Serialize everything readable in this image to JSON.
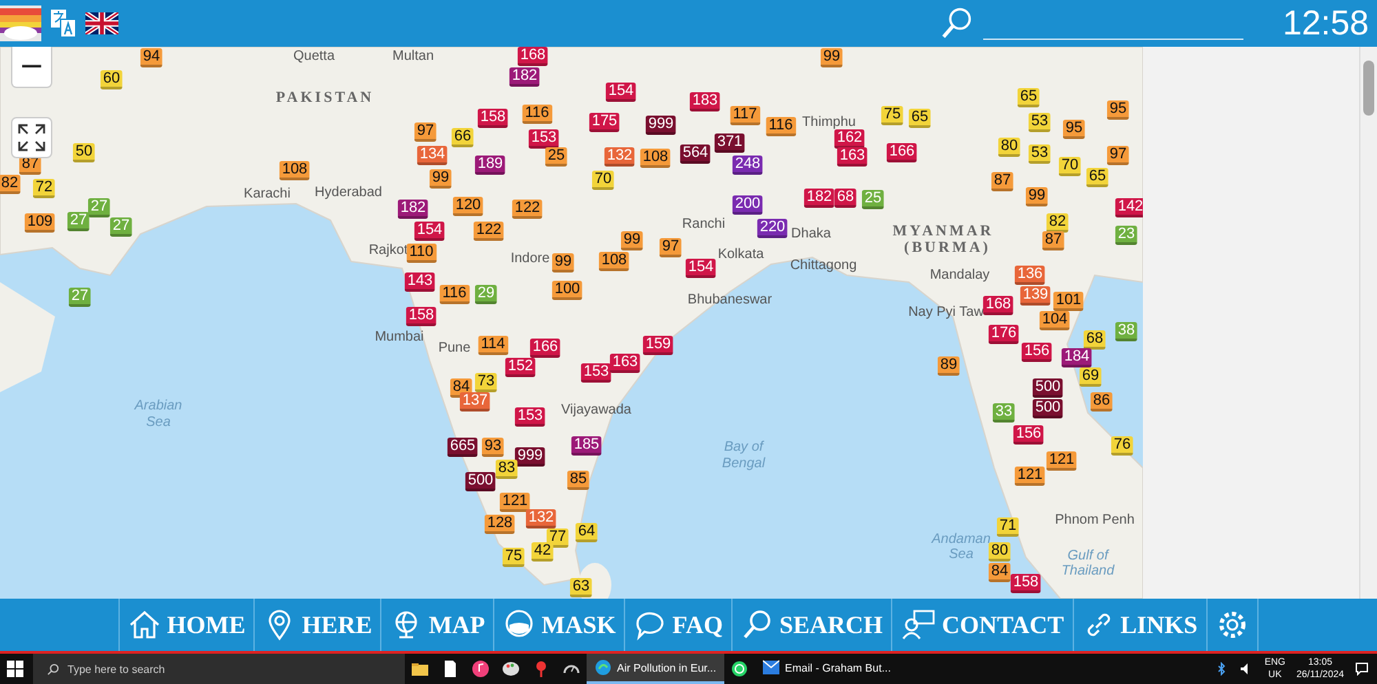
{
  "top_bar": {
    "time": "12:58"
  },
  "map": {
    "zoom_out": "−",
    "labels": [
      {
        "text": "Quetta",
        "kind": "city"
      },
      {
        "text": "Multan",
        "kind": "city"
      },
      {
        "text": "PAKISTAN",
        "kind": "country"
      },
      {
        "text": "Karachi",
        "kind": "city"
      },
      {
        "text": "Hyderabad",
        "kind": "city"
      },
      {
        "text": "Rajkot",
        "kind": "city"
      },
      {
        "text": "Indore",
        "kind": "city"
      },
      {
        "text": "Mumbai",
        "kind": "city"
      },
      {
        "text": "Pune",
        "kind": "city"
      },
      {
        "text": "Vijayawada",
        "kind": "city"
      },
      {
        "text": "Ranchi",
        "kind": "city"
      },
      {
        "text": "Kolkata",
        "kind": "city"
      },
      {
        "text": "Dhaka",
        "kind": "city"
      },
      {
        "text": "Chittagong",
        "kind": "city"
      },
      {
        "text": "Bhubaneswar",
        "kind": "city"
      },
      {
        "text": "Thimphu",
        "kind": "city"
      },
      {
        "text": "MYANMAR",
        "kind": "country"
      },
      {
        "text": "(BURMA)",
        "kind": "country"
      },
      {
        "text": "Mandalay",
        "kind": "city"
      },
      {
        "text": "Nay Pyi Taw",
        "kind": "city"
      },
      {
        "text": "Arabian",
        "kind": "sea"
      },
      {
        "text": "Sea",
        "kind": "sea"
      },
      {
        "text": "Bay of",
        "kind": "sea"
      },
      {
        "text": "Bengal",
        "kind": "sea"
      },
      {
        "text": "Phnom Penh",
        "kind": "city"
      },
      {
        "text": "Andaman",
        "kind": "sea"
      },
      {
        "text": "Sea",
        "kind": "sea"
      },
      {
        "text": "Gulf of",
        "kind": "sea"
      },
      {
        "text": "Thailand",
        "kind": "sea"
      }
    ],
    "markers": [
      {
        "value": "94",
        "color": "#f59a3a"
      },
      {
        "value": "60",
        "color": "#f2d43a"
      },
      {
        "value": "50",
        "color": "#f2d43a"
      },
      {
        "value": "87",
        "color": "#f59a3a"
      },
      {
        "value": "82",
        "color": "#f59a3a"
      },
      {
        "value": "72",
        "color": "#f2d43a"
      },
      {
        "value": "109",
        "color": "#f59a3a"
      },
      {
        "value": "27",
        "color": "#6fb040"
      },
      {
        "value": "27",
        "color": "#6fb040"
      },
      {
        "value": "27",
        "color": "#6fb040"
      },
      {
        "value": "27",
        "color": "#6fb040"
      },
      {
        "value": "108",
        "color": "#f59a3a"
      },
      {
        "value": "97",
        "color": "#f59a3a"
      },
      {
        "value": "66",
        "color": "#f2d43a"
      },
      {
        "value": "134",
        "color": "#e8663a"
      },
      {
        "value": "158",
        "color": "#d01648"
      },
      {
        "value": "153",
        "color": "#d01648"
      },
      {
        "value": "189",
        "color": "#9c1a78"
      },
      {
        "value": "99",
        "color": "#f59a3a"
      },
      {
        "value": "25",
        "color": "#f59a3a"
      },
      {
        "value": "182",
        "color": "#9c1a78"
      },
      {
        "value": "154",
        "color": "#d01648"
      },
      {
        "value": "120",
        "color": "#f59a3a"
      },
      {
        "value": "122",
        "color": "#f59a3a"
      },
      {
        "value": "122",
        "color": "#f59a3a"
      },
      {
        "value": "110",
        "color": "#f59a3a"
      },
      {
        "value": "99",
        "color": "#f59a3a"
      },
      {
        "value": "143",
        "color": "#d01648"
      },
      {
        "value": "116",
        "color": "#f59a3a"
      },
      {
        "value": "29",
        "color": "#6fb040"
      },
      {
        "value": "100",
        "color": "#f59a3a"
      },
      {
        "value": "158",
        "color": "#d01648"
      },
      {
        "value": "168",
        "color": "#d01648"
      },
      {
        "value": "182",
        "color": "#9c1a78"
      },
      {
        "value": "116",
        "color": "#f59a3a"
      },
      {
        "value": "99",
        "color": "#f59a3a"
      },
      {
        "value": "154",
        "color": "#d01648"
      },
      {
        "value": "183",
        "color": "#d01648"
      },
      {
        "value": "175",
        "color": "#d01648"
      },
      {
        "value": "999",
        "color": "#7a0f2f"
      },
      {
        "value": "117",
        "color": "#f59a3a"
      },
      {
        "value": "116",
        "color": "#f59a3a"
      },
      {
        "value": "564",
        "color": "#7a0f2f"
      },
      {
        "value": "371",
        "color": "#7a0f2f"
      },
      {
        "value": "248",
        "color": "#7a2bb0"
      },
      {
        "value": "132",
        "color": "#e8663a"
      },
      {
        "value": "108",
        "color": "#f59a3a"
      },
      {
        "value": "70",
        "color": "#f2d43a"
      },
      {
        "value": "162",
        "color": "#d01648"
      },
      {
        "value": "163",
        "color": "#d01648"
      },
      {
        "value": "166",
        "color": "#d01648"
      },
      {
        "value": "75",
        "color": "#f2d43a"
      },
      {
        "value": "65",
        "color": "#f2d43a"
      },
      {
        "value": "182",
        "color": "#d01648"
      },
      {
        "value": "68",
        "color": "#d01648"
      },
      {
        "value": "25",
        "color": "#6fb040"
      },
      {
        "value": "200",
        "color": "#7a2bb0"
      },
      {
        "value": "220",
        "color": "#7a2bb0"
      },
      {
        "value": "99",
        "color": "#f59a3a"
      },
      {
        "value": "97",
        "color": "#f59a3a"
      },
      {
        "value": "108",
        "color": "#f59a3a"
      },
      {
        "value": "154",
        "color": "#d01648"
      },
      {
        "value": "65",
        "color": "#f2d43a"
      },
      {
        "value": "53",
        "color": "#f2d43a"
      },
      {
        "value": "95",
        "color": "#f59a3a"
      },
      {
        "value": "95",
        "color": "#f59a3a"
      },
      {
        "value": "80",
        "color": "#f2d43a"
      },
      {
        "value": "53",
        "color": "#f2d43a"
      },
      {
        "value": "97",
        "color": "#f59a3a"
      },
      {
        "value": "87",
        "color": "#f59a3a"
      },
      {
        "value": "70",
        "color": "#f2d43a"
      },
      {
        "value": "65",
        "color": "#f2d43a"
      },
      {
        "value": "99",
        "color": "#f59a3a"
      },
      {
        "value": "142",
        "color": "#d01648"
      },
      {
        "value": "82",
        "color": "#f2d43a"
      },
      {
        "value": "87",
        "color": "#f59a3a"
      },
      {
        "value": "23",
        "color": "#6fb040"
      },
      {
        "value": "136",
        "color": "#e8663a"
      },
      {
        "value": "139",
        "color": "#e8663a"
      },
      {
        "value": "168",
        "color": "#d01648"
      },
      {
        "value": "101",
        "color": "#f59a3a"
      },
      {
        "value": "104",
        "color": "#f59a3a"
      },
      {
        "value": "176",
        "color": "#d01648"
      },
      {
        "value": "68",
        "color": "#f2d43a"
      },
      {
        "value": "38",
        "color": "#6fb040"
      },
      {
        "value": "184",
        "color": "#9c1a78"
      },
      {
        "value": "156",
        "color": "#d01648"
      },
      {
        "value": "69",
        "color": "#f2d43a"
      },
      {
        "value": "89",
        "color": "#f59a3a"
      },
      {
        "value": "500",
        "color": "#7a0f2f"
      },
      {
        "value": "86",
        "color": "#f59a3a"
      },
      {
        "value": "33",
        "color": "#6fb040"
      },
      {
        "value": "500",
        "color": "#7a0f2f"
      },
      {
        "value": "156",
        "color": "#d01648"
      },
      {
        "value": "121",
        "color": "#f59a3a"
      },
      {
        "value": "76",
        "color": "#f2d43a"
      },
      {
        "value": "121",
        "color": "#f59a3a"
      },
      {
        "value": "71",
        "color": "#f2d43a"
      },
      {
        "value": "80",
        "color": "#f2d43a"
      },
      {
        "value": "84",
        "color": "#f59a3a"
      },
      {
        "value": "158",
        "color": "#d01648"
      },
      {
        "value": "114",
        "color": "#f59a3a"
      },
      {
        "value": "166",
        "color": "#d01648"
      },
      {
        "value": "152",
        "color": "#d01648"
      },
      {
        "value": "153",
        "color": "#d01648"
      },
      {
        "value": "163",
        "color": "#d01648"
      },
      {
        "value": "73",
        "color": "#f2d43a"
      },
      {
        "value": "84",
        "color": "#f59a3a"
      },
      {
        "value": "137",
        "color": "#e8663a"
      },
      {
        "value": "153",
        "color": "#d01648"
      },
      {
        "value": "159",
        "color": "#d01648"
      },
      {
        "value": "665",
        "color": "#7a0f2f"
      },
      {
        "value": "93",
        "color": "#f59a3a"
      },
      {
        "value": "999",
        "color": "#7a0f2f"
      },
      {
        "value": "185",
        "color": "#9c1a78"
      },
      {
        "value": "500",
        "color": "#7a0f2f"
      },
      {
        "value": "83",
        "color": "#f2d43a"
      },
      {
        "value": "85",
        "color": "#f59a3a"
      },
      {
        "value": "121",
        "color": "#f59a3a"
      },
      {
        "value": "132",
        "color": "#e8663a"
      },
      {
        "value": "128",
        "color": "#f59a3a"
      },
      {
        "value": "77",
        "color": "#f2d43a"
      },
      {
        "value": "64",
        "color": "#f2d43a"
      },
      {
        "value": "75",
        "color": "#f2d43a"
      },
      {
        "value": "42",
        "color": "#f2d43a"
      },
      {
        "value": "63",
        "color": "#f2d43a"
      }
    ]
  },
  "nav": [
    {
      "label": "HOME",
      "kind": "home"
    },
    {
      "label": "HERE",
      "kind": "here"
    },
    {
      "label": "MAP",
      "kind": "map"
    },
    {
      "label": "MASK",
      "kind": "mask"
    },
    {
      "label": "FAQ",
      "kind": "faq"
    },
    {
      "label": "SEARCH",
      "kind": "search"
    },
    {
      "label": "CONTACT",
      "kind": "contact"
    },
    {
      "label": "LINKS",
      "kind": "links"
    },
    {
      "kind": "settings"
    }
  ],
  "taskbar": {
    "search_placeholder": "Type here to search",
    "apps": [
      {
        "label": "Air Pollution in Eur...",
        "selected": true
      },
      {
        "label": "Email - Graham But...",
        "selected": false
      }
    ],
    "language": "ENG",
    "region": "UK",
    "time": "13:05",
    "date": "26/11/2024"
  }
}
